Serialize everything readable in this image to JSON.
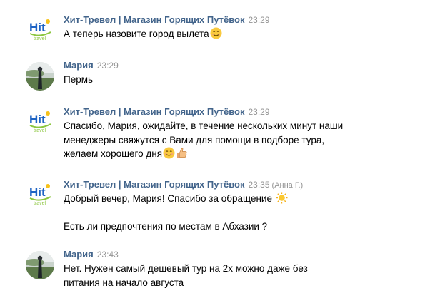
{
  "messages": [
    {
      "author": "Хит-Тревел | Магазин Горящих Путёвок",
      "time": "23:29",
      "avatar": "hit-travel-logo",
      "lines": [
        "А теперь назовите город вылета"
      ],
      "trailing_emoji": "smile-emoji"
    },
    {
      "author": "Мария",
      "time": "23:29",
      "avatar": "user-photo",
      "lines": [
        "Пермь"
      ]
    },
    {
      "author": "Хит-Тревел | Магазин Горящих Путёвок",
      "time": "23:29",
      "avatar": "hit-travel-logo",
      "lines": [
        "Спасибо, Мария, ожидайте, в течение нескольких минут наши",
        "менеджеры свяжутся с Вами для помощи в подборе тура,",
        "желаем хорошего дня"
      ],
      "trailing_emoji": [
        "smile-emoji",
        "thumbs-up-emoji"
      ]
    },
    {
      "author": "Хит-Тревел | Магазин Горящих Путёвок",
      "time": "23:35",
      "sender_note": "(Анна Г.)",
      "avatar": "hit-travel-logo",
      "lines": [
        "Добрый вечер, Мария! Спасибо за обращение",
        "",
        "Есть ли предпочтения по местам в Абхазии ?"
      ],
      "trailing_emoji": "sun-emoji"
    },
    {
      "author": "Мария",
      "time": "23:43",
      "avatar": "user-photo",
      "lines": [
        "Нет. Нужен самый дешевый тур на 2х можно даже без",
        "питания на начало августа"
      ]
    }
  ],
  "logo": {
    "text": "Hit",
    "subtext": "travel"
  },
  "colors": {
    "author": "#42648b",
    "time": "#939393",
    "text": "#000000",
    "logo_blue": "#1e63c4",
    "logo_green": "#8cc63f",
    "logo_yellow": "#f6c21b"
  }
}
